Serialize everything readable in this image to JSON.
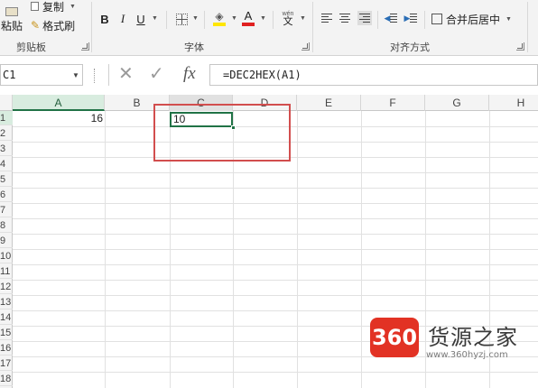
{
  "ribbon": {
    "clipboard": {
      "paste_label": "粘贴",
      "copy_label": "复制",
      "format_painter_label": "格式刷",
      "group_label": "剪贴板"
    },
    "font": {
      "bold": "B",
      "italic": "I",
      "underline": "U",
      "font_color_letter": "A",
      "group_label": "字体"
    },
    "alignment": {
      "wen_label": "wén",
      "wen_char": "文",
      "merge_center_label": "合并后居中",
      "group_label": "对齐方式"
    }
  },
  "formula_bar": {
    "name_box": "C1",
    "fx": "fx",
    "formula": "=DEC2HEX(A1)"
  },
  "sheet": {
    "columns": [
      "A",
      "B",
      "C",
      "D",
      "E",
      "F",
      "G",
      "H"
    ],
    "rows": [
      "1",
      "2",
      "3",
      "4",
      "5",
      "6",
      "7",
      "8",
      "9",
      "10",
      "11",
      "12",
      "13",
      "14",
      "15",
      "16",
      "17",
      "18"
    ],
    "cells": {
      "A1": "16",
      "C1": "10"
    }
  },
  "watermark": {
    "logo": "360",
    "name": "货源之家",
    "url": "www.360hyzj.com"
  },
  "colors": {
    "excel_green": "#217346",
    "annotation_red": "#d24e4e",
    "font_color_red": "#e02020",
    "highlight_yellow": "#ffe600"
  }
}
